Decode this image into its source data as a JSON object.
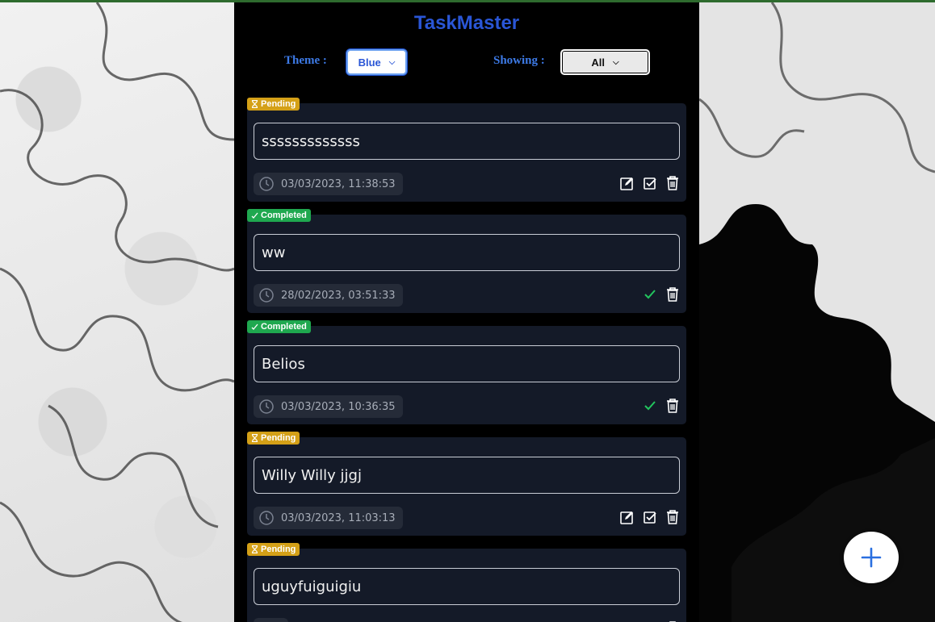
{
  "app": {
    "title": "TaskMaster"
  },
  "controls": {
    "theme_label": "Theme :",
    "theme_value": "Blue",
    "showing_label": "Showing :",
    "showing_value": "All"
  },
  "tasks": [
    {
      "status": "Pending",
      "text": "sssssssssssss",
      "timestamp": "03/03/2023, 11:38:53",
      "actions": [
        "edit-icon",
        "check-square-icon",
        "trash-icon"
      ]
    },
    {
      "status": "Completed",
      "text": "ww",
      "timestamp": "28/02/2023, 03:51:33",
      "actions": [
        "check-icon",
        "trash-icon"
      ]
    },
    {
      "status": "Completed",
      "text": "Belios",
      "timestamp": "03/03/2023, 10:36:35",
      "actions": [
        "check-icon",
        "trash-icon"
      ]
    },
    {
      "status": "Pending",
      "text": "Willy Willy jjgj",
      "timestamp": "03/03/2023, 11:03:13",
      "actions": [
        "edit-icon",
        "check-square-icon",
        "trash-icon"
      ]
    },
    {
      "status": "Pending",
      "text": "uguyfuiguigiu",
      "timestamp": "",
      "actions": [
        "edit-icon",
        "check-square-icon",
        "trash-icon"
      ]
    }
  ],
  "colors": {
    "title": "#2a56d6",
    "pending": "#d4a017",
    "completed": "#1fa84f",
    "card_bg": "#141a28"
  },
  "fab": {
    "icon": "plus-icon"
  }
}
